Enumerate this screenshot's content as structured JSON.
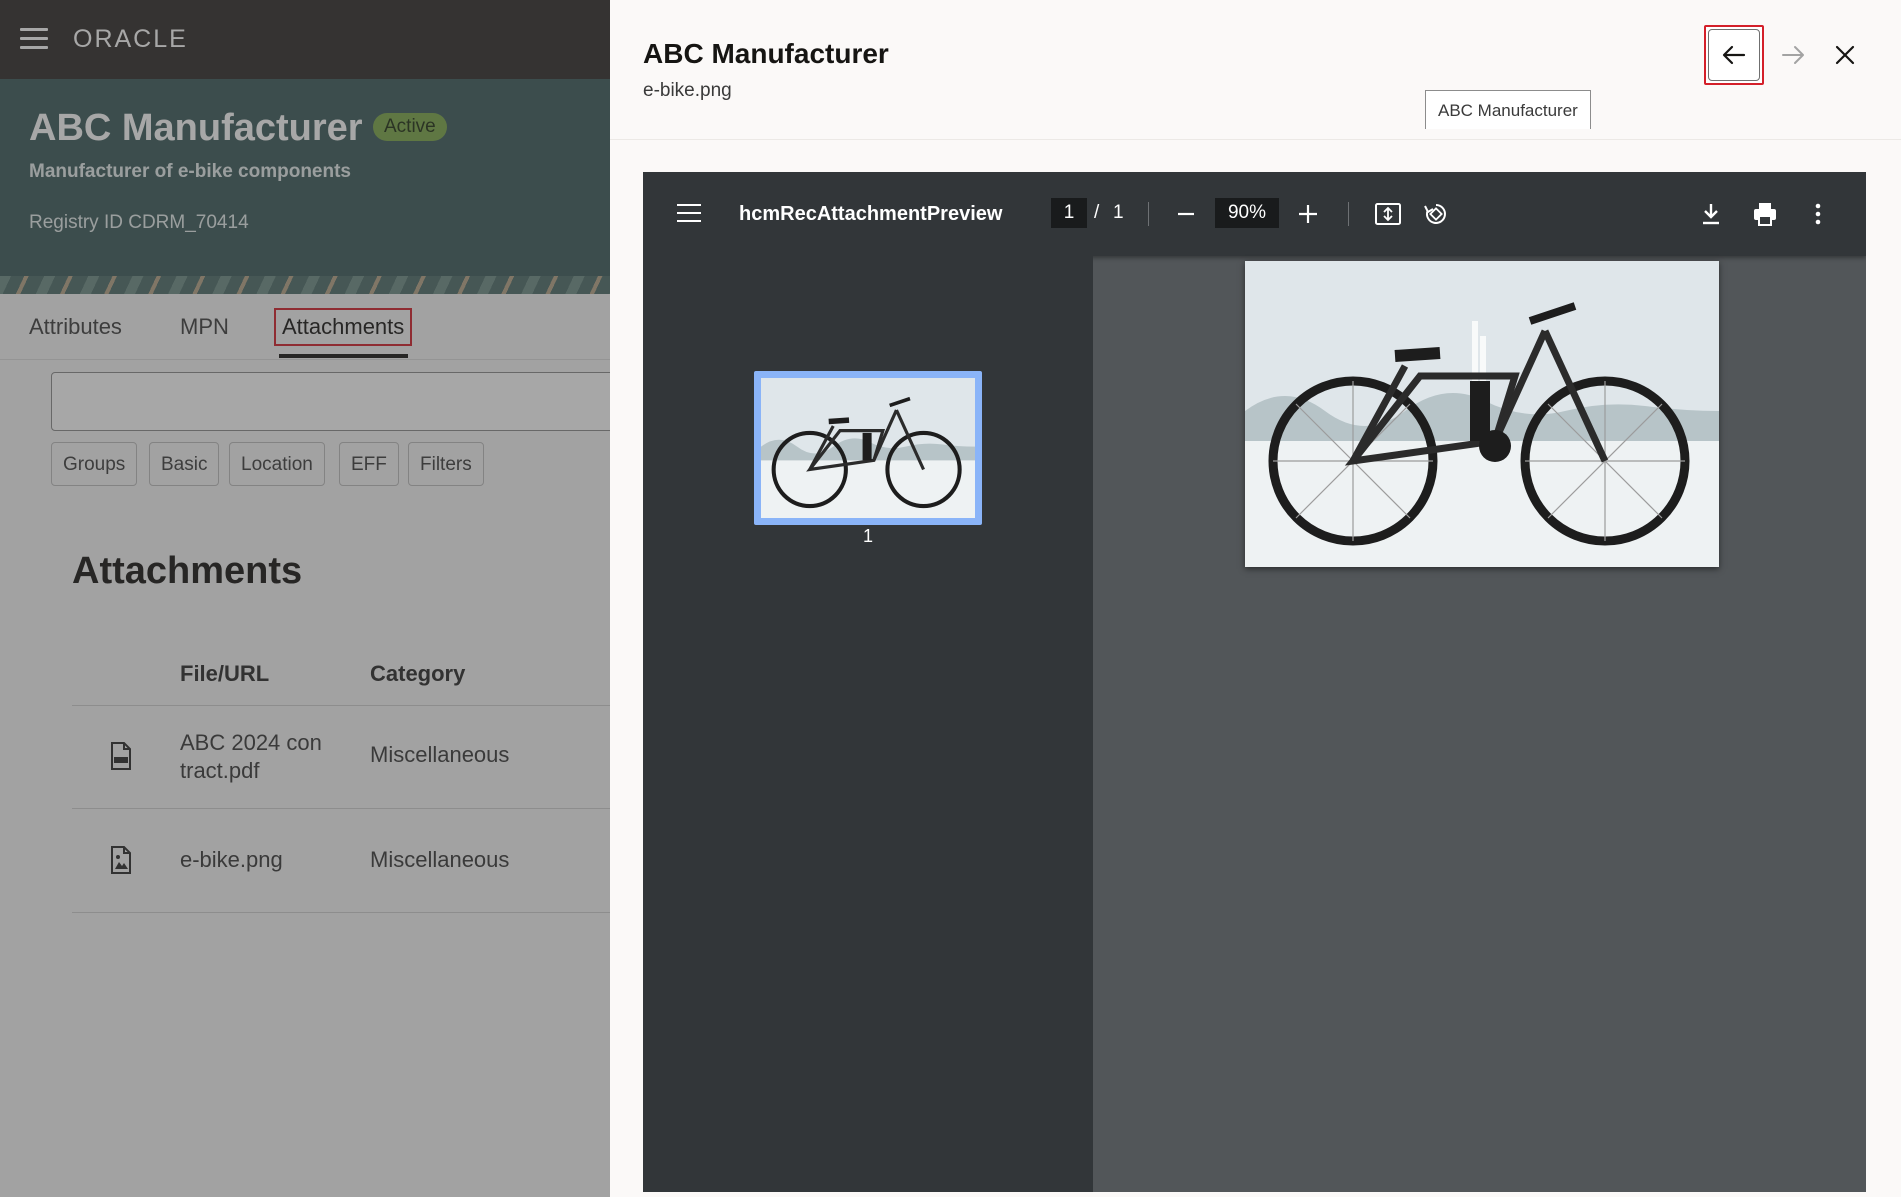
{
  "app": {
    "brand": "ORACLE"
  },
  "record": {
    "title": "ABC Manufacturer",
    "status": "Active",
    "subtitle": "Manufacturer of e-bike components",
    "registry": "Registry ID CDRM_70414"
  },
  "tabs": [
    {
      "label": "Attributes"
    },
    {
      "label": "MPN"
    },
    {
      "label": "Attachments",
      "selected": true
    }
  ],
  "filters": {
    "search_placeholder": "",
    "chips": [
      "Groups",
      "Basic",
      "Location",
      "EFF",
      "Filters"
    ]
  },
  "attachments": {
    "heading": "Attachments",
    "columns": [
      "File/URL",
      "Category"
    ],
    "rows": [
      {
        "file": "ABC 2024 con tract.pdf",
        "file_line1": "ABC 2024 con",
        "file_line2": "tract.pdf",
        "category": "Miscellaneous",
        "icon": "pdf-file-icon"
      },
      {
        "file": "e-bike.png",
        "category": "Miscellaneous",
        "icon": "image-file-icon"
      }
    ]
  },
  "drawer": {
    "title": "ABC Manufacturer",
    "subtitle": "e-bike.png",
    "tooltip": "ABC Manufacturer",
    "icons": [
      "arrow-left-icon",
      "arrow-right-icon",
      "close-icon"
    ]
  },
  "viewer": {
    "filename": "hcmRecAttachmentPreview",
    "page_current": "1",
    "page_separator": "/",
    "page_total": "1",
    "zoom": "90%",
    "thumbnail_label": "1",
    "icons": [
      "menu-icon",
      "minus-icon",
      "plus-icon",
      "fit-page-icon",
      "rotate-icon",
      "download-icon",
      "print-icon",
      "more-vertical-icon"
    ]
  },
  "colors": {
    "topbar": "#312d2a",
    "hero": "#3d5c5c",
    "active_badge": "#7ca84a",
    "highlight": "#d4202a",
    "viewer_toolbar": "#323639",
    "viewer_bg": "#525659",
    "thumb_selected": "#8ab4f8"
  }
}
